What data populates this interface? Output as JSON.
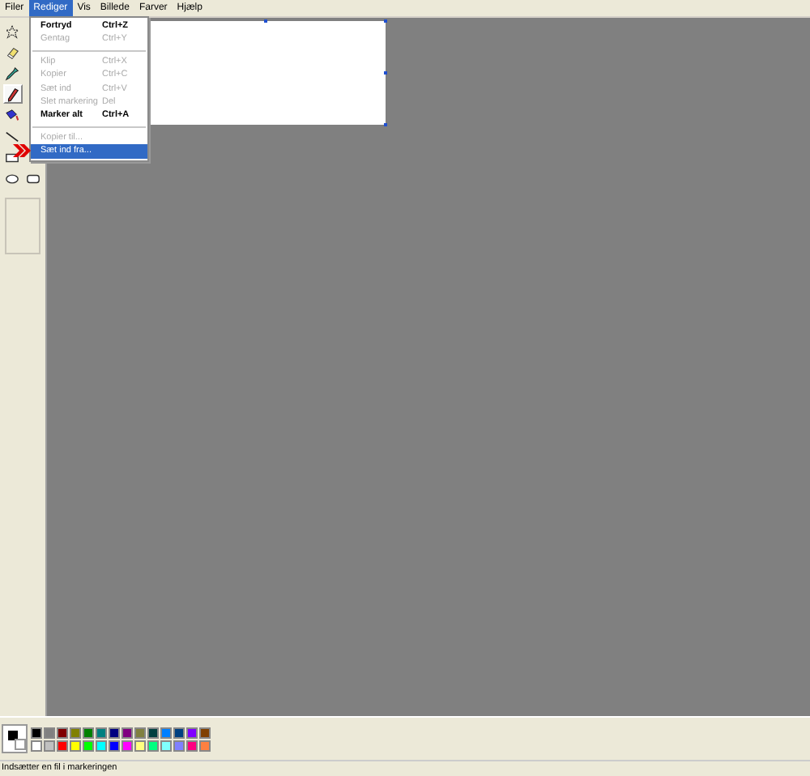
{
  "menubar": [
    {
      "label": "Filer",
      "selected": false
    },
    {
      "label": "Rediger",
      "selected": true
    },
    {
      "label": "Vis",
      "selected": false
    },
    {
      "label": "Billede",
      "selected": false
    },
    {
      "label": "Farver",
      "selected": false
    },
    {
      "label": "Hjælp",
      "selected": false
    }
  ],
  "menu": [
    {
      "kind": "item",
      "label": "Fortryd",
      "shortcut": "Ctrl+Z",
      "disabled": false,
      "selected": false
    },
    {
      "kind": "item",
      "label": "Gentag",
      "shortcut": "Ctrl+Y",
      "disabled": true,
      "selected": false
    },
    {
      "kind": "separator"
    },
    {
      "kind": "item",
      "label": "Klip",
      "shortcut": "Ctrl+X",
      "disabled": true,
      "selected": false
    },
    {
      "kind": "item",
      "label": "Kopier",
      "shortcut": "Ctrl+C",
      "disabled": true,
      "selected": false
    },
    {
      "kind": "item",
      "label": "Sæt ind",
      "shortcut": "Ctrl+V",
      "disabled": true,
      "selected": false
    },
    {
      "kind": "item",
      "label": "Slet markering",
      "shortcut": "Del",
      "disabled": true,
      "selected": false
    },
    {
      "kind": "item",
      "label": "Marker alt",
      "shortcut": "Ctrl+A",
      "disabled": false,
      "selected": false
    },
    {
      "kind": "separator"
    },
    {
      "kind": "item",
      "label": "Kopier til...",
      "disabled": true,
      "selected": false
    },
    {
      "kind": "item",
      "label": "Sæt ind fra...",
      "disabled": false,
      "selected": true
    }
  ],
  "tools": [
    {
      "kind": "select",
      "selected": false
    },
    {
      "kind": "eraser",
      "selected": false
    },
    {
      "kind": "picker",
      "selected": false
    },
    {
      "kind": "pencil",
      "selected": true
    },
    {
      "kind": "fill",
      "selected": false
    },
    {
      "kind": "line",
      "selected": false
    },
    {
      "kind": "rect",
      "selected": false
    },
    {
      "kind": "ellipse",
      "selected": false
    },
    {
      "kind": "roundrect",
      "selected": false
    }
  ],
  "palette": {
    "current": [
      {
        "kind": "foreground",
        "color": "#000000"
      },
      {
        "kind": "background",
        "color": "#ffffff"
      }
    ],
    "colors": [
      {
        "color": "#000000"
      },
      {
        "color": "#808080"
      },
      {
        "color": "#800000"
      },
      {
        "color": "#808000"
      },
      {
        "color": "#008000"
      },
      {
        "color": "#008080"
      },
      {
        "color": "#000080"
      },
      {
        "color": "#800080"
      },
      {
        "color": "#808040"
      },
      {
        "color": "#004040"
      },
      {
        "color": "#0080ff"
      },
      {
        "color": "#004080"
      },
      {
        "color": "#8000ff"
      },
      {
        "color": "#804000"
      },
      {
        "color": "#ffffff"
      },
      {
        "color": "#c0c0c0"
      },
      {
        "color": "#ff0000"
      },
      {
        "color": "#ffff00"
      },
      {
        "color": "#00ff00"
      },
      {
        "color": "#00ffff"
      },
      {
        "color": "#0000ff"
      },
      {
        "color": "#ff00ff"
      },
      {
        "color": "#ffff80"
      },
      {
        "color": "#00ff80"
      },
      {
        "color": "#80ffff"
      },
      {
        "color": "#8080ff"
      },
      {
        "color": "#ff0080"
      },
      {
        "color": "#ff8040"
      }
    ]
  },
  "status_bar": "Indsætter en fil i markeringen"
}
